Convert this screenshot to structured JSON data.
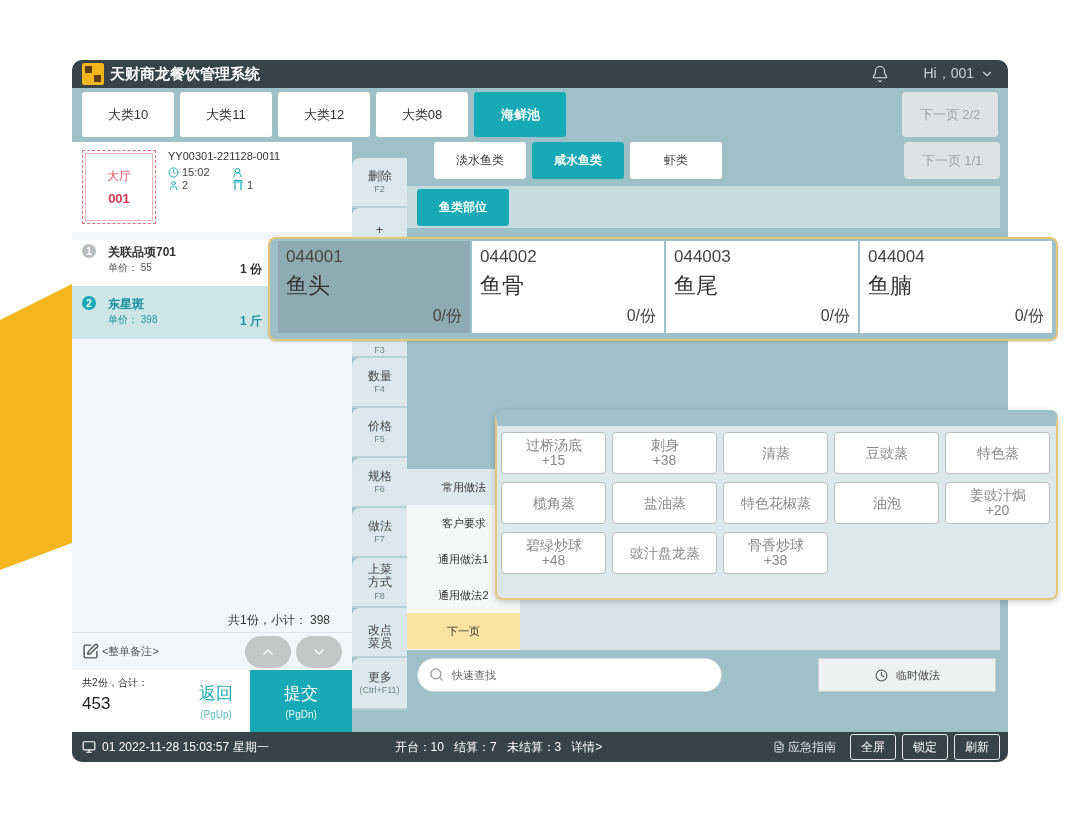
{
  "window": {
    "title": "天财商龙餐饮管理系统",
    "user": "Hi，001"
  },
  "categories": [
    {
      "label": "大类10",
      "selected": false
    },
    {
      "label": "大类11",
      "selected": false
    },
    {
      "label": "大类12",
      "selected": false
    },
    {
      "label": "大类08",
      "selected": false
    },
    {
      "label": "海鲜池",
      "selected": true
    }
  ],
  "category_next": {
    "label": "下一页 2/2",
    "disabled": true
  },
  "order": {
    "area": "大厅",
    "table": "001",
    "number": "YY00301-221128-0011",
    "time": "15:02",
    "guests": "2",
    "tables": "1"
  },
  "items": [
    {
      "index": "1",
      "name": "关联品项701",
      "price_label": "单价：",
      "price": "55",
      "qty": "1 份",
      "selected": false
    },
    {
      "index": "2",
      "name": "东星斑",
      "price_label": "单价：",
      "price": "398",
      "qty": "1 斤",
      "selected": true
    }
  ],
  "subtotal": "共1份，小计： 398",
  "note": "<整单备注>",
  "total": {
    "label": "共2份，合计：",
    "value": "453"
  },
  "back": {
    "label": "返回",
    "key": "(PgUp)"
  },
  "submit": {
    "label": "提交",
    "key": "(PgDn)"
  },
  "functions": [
    {
      "label": "删除",
      "key": "F2"
    },
    {
      "label": "+"
    },
    {
      "key": "F3"
    },
    {
      "label": "数量",
      "key": "F4"
    },
    {
      "label": "价格",
      "key": "F5"
    },
    {
      "label": "规格",
      "key": "F6"
    },
    {
      "label": "做法",
      "key": "F7"
    },
    {
      "label": "上菜方式",
      "key": "F8"
    },
    {
      "label": "改点菜员"
    },
    {
      "label": "更多",
      "key": "(Ctrl+F11)"
    }
  ],
  "subcategories": [
    {
      "label": "淡水鱼类",
      "selected": false
    },
    {
      "label": "咸水鱼类",
      "selected": true
    },
    {
      "label": "虾类",
      "selected": false
    }
  ],
  "subcategory_next": {
    "label": "下一页 1/1",
    "disabled": true
  },
  "groups": [
    {
      "label": "鱼类部位",
      "selected": true
    }
  ],
  "method_tabs": [
    {
      "kind": "tab",
      "label": "常用做法",
      "selected": true
    },
    {
      "kind": "tab",
      "label": "客户要求",
      "selected": false
    },
    {
      "kind": "tab",
      "label": "通用做法1",
      "selected": false
    },
    {
      "kind": "tab",
      "label": "通用做法2",
      "selected": false
    },
    {
      "kind": "next",
      "label": "下一页",
      "selected": false
    }
  ],
  "search": {
    "placeholder": "快速查找"
  },
  "temp_method": {
    "label": "临时做法"
  },
  "status_bar": {
    "terminal": "01 2022-11-28 15:03:57 星期一",
    "stats": [
      "开台：10",
      "结算：7",
      "未结算：3"
    ],
    "details": "详情>",
    "guide": "应急指南",
    "buttons": [
      "全屏",
      "锁定",
      "刷新"
    ]
  },
  "dish_popup": {
    "dishes": [
      {
        "code": "044001",
        "name": "鱼头",
        "stock": "0/份",
        "selected": true
      },
      {
        "code": "044002",
        "name": "鱼骨",
        "stock": "0/份",
        "selected": false
      },
      {
        "code": "044003",
        "name": "鱼尾",
        "stock": "0/份",
        "selected": false
      },
      {
        "code": "044004",
        "name": "鱼腩",
        "stock": "0/份",
        "selected": false
      }
    ]
  },
  "method_popup": {
    "methods": [
      {
        "name": "过桥汤底",
        "price": "+15"
      },
      {
        "name": "刺身",
        "price": "+38"
      },
      {
        "name": "清蒸"
      },
      {
        "name": "豆豉蒸"
      },
      {
        "name": "特色蒸"
      },
      {
        "name": "榄角蒸"
      },
      {
        "name": "盐油蒸"
      },
      {
        "name": "特色花椒蒸"
      },
      {
        "name": "油泡"
      },
      {
        "name": "姜豉汁焗",
        "price": "+20"
      },
      {
        "name": "碧绿炒球",
        "price": "+48"
      },
      {
        "name": "豉汁盘龙蒸"
      },
      {
        "name": "骨香炒球",
        "price": "+38"
      }
    ]
  }
}
